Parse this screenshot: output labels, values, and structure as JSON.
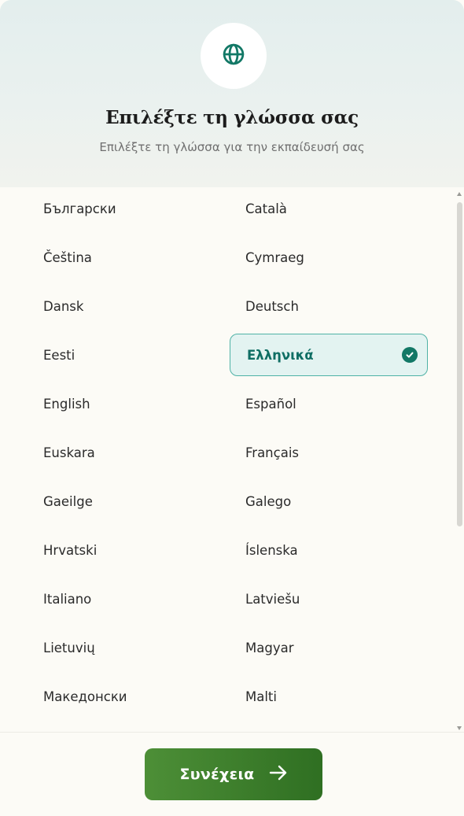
{
  "header": {
    "title": "Επιλέξτε τη γλώσσα σας",
    "subtitle": "Επιλέξτε τη γλώσσα για την εκπαίδευσή σας",
    "icon": "globe-icon"
  },
  "languages": {
    "left": [
      "Български",
      "Čeština",
      "Dansk",
      "Eesti",
      "English",
      "Euskara",
      "Gaeilge",
      "Hrvatski",
      "Italiano",
      "Lietuvių",
      "Македонски"
    ],
    "right": [
      "Català",
      "Cymraeg",
      "Deutsch",
      "Ελληνικά",
      "Español",
      "Français",
      "Galego",
      "Íslenska",
      "Latviešu",
      "Magyar",
      "Malti"
    ]
  },
  "selected_language": "Ελληνικά",
  "footer": {
    "continue_label": "Συνέχεια"
  },
  "colors": {
    "accent": "#127866",
    "selected_border": "#4fb2a6",
    "selected_bg": "#e3f3f1",
    "button_start": "#4d8f37",
    "button_end": "#2f6f22"
  }
}
